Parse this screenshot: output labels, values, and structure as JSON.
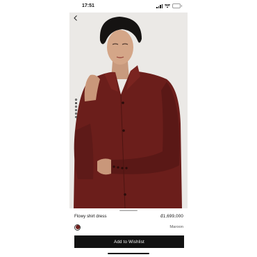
{
  "status_bar": {
    "time": "17:51"
  },
  "product": {
    "name": "Flowy shirt dress",
    "price": "đ1,699,000",
    "selected_color": "Maroon",
    "swatch_color": "#6e1f1c"
  },
  "carousel": {
    "total_images": 6,
    "active_index": 1
  },
  "actions": {
    "wishlist_label": "Add to Wishlist"
  },
  "colors": {
    "accent": "#111111",
    "background": "#ebe9e6",
    "dress": "#6b1e1b"
  },
  "icons": {
    "back": "chevron-left-icon"
  }
}
